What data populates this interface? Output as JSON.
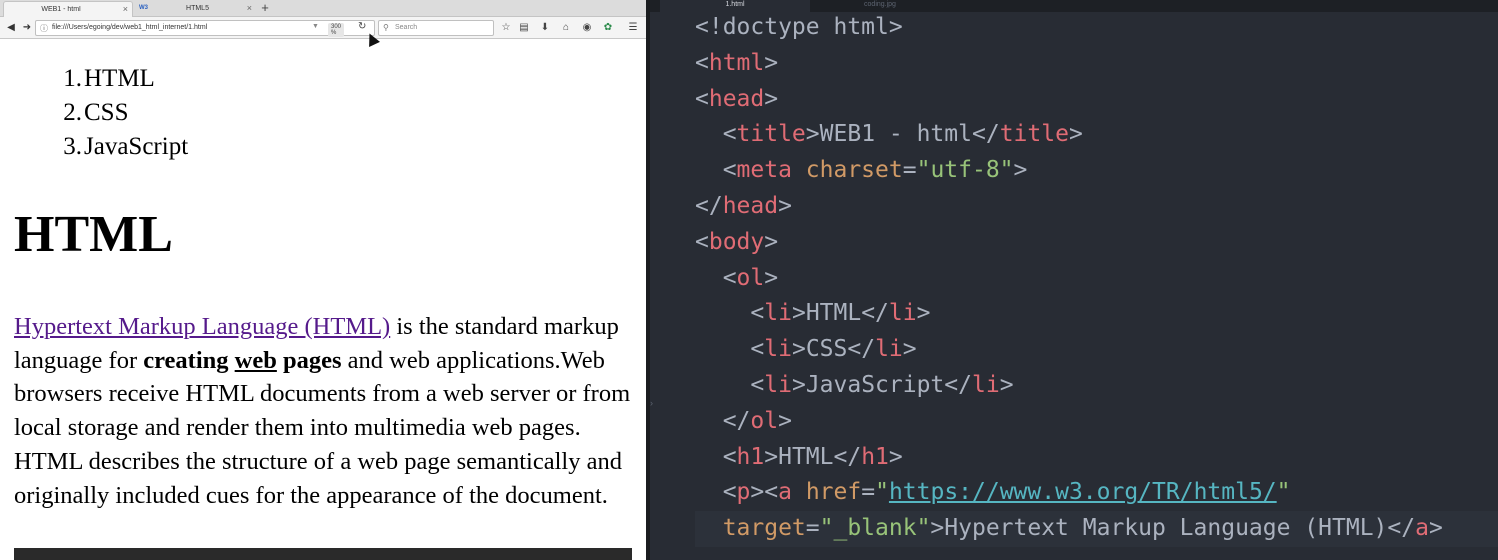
{
  "browser": {
    "tabs": [
      {
        "label": "WEB1 - html",
        "active": true
      },
      {
        "label": "",
        "favicon": "W3",
        "active": false
      },
      {
        "label": "HTML5",
        "active": false
      }
    ],
    "close_glyph": "×",
    "new_tab_glyph": "+",
    "url": "file:///Users/egoing/dev/web1_html_internet/1.html",
    "zoom": "300 %",
    "search_placeholder": "Search",
    "icons": {
      "back": "back-arrow-icon",
      "forward": "forward-arrow-icon",
      "info": "info-icon",
      "reload": "reload-icon",
      "search": "search-icon",
      "bookmark": "star-icon",
      "library": "clipboard-icon",
      "download": "download-icon",
      "home": "home-icon",
      "pocket": "pocket-icon",
      "extension": "extension-icon",
      "menu": "hamburger-menu-icon"
    }
  },
  "page": {
    "list": [
      {
        "num": "1.",
        "text": "HTML"
      },
      {
        "num": "2.",
        "text": "CSS"
      },
      {
        "num": "3.",
        "text": "JavaScript"
      }
    ],
    "heading": "HTML",
    "paragraph": {
      "link_text": "Hypertext Markup Language (HTML)",
      "text1": " is the standard markup language for ",
      "bold1": "creating ",
      "bold_underline": "web",
      "bold2": " pages",
      "text2": " and web applications.Web browsers receive HTML documents from a web server or from local storage and render them into multimedia web pages. HTML describes the structure of a web page semantically and originally included cues for the appearance of the document."
    }
  },
  "editor": {
    "tabs": [
      {
        "label": "1.html",
        "active": true
      },
      {
        "label": "coding.jpg",
        "active": false
      }
    ],
    "gutter_mark": "›",
    "lines": [
      [
        {
          "c": "punc",
          "t": "<!doctype html>"
        }
      ],
      [
        {
          "c": "punc",
          "t": "<"
        },
        {
          "c": "tag",
          "t": "html"
        },
        {
          "c": "punc",
          "t": ">"
        }
      ],
      [
        {
          "c": "punc",
          "t": "<"
        },
        {
          "c": "tag",
          "t": "head"
        },
        {
          "c": "punc",
          "t": ">"
        }
      ],
      [
        {
          "c": "punc",
          "t": "  <"
        },
        {
          "c": "tag",
          "t": "title"
        },
        {
          "c": "punc",
          "t": ">"
        },
        {
          "c": "txt",
          "t": "WEB1 - html"
        },
        {
          "c": "punc",
          "t": "</"
        },
        {
          "c": "tag",
          "t": "title"
        },
        {
          "c": "punc",
          "t": ">"
        }
      ],
      [
        {
          "c": "punc",
          "t": "  <"
        },
        {
          "c": "tag",
          "t": "meta"
        },
        {
          "c": "punc",
          "t": " "
        },
        {
          "c": "attr",
          "t": "charset"
        },
        {
          "c": "punc",
          "t": "="
        },
        {
          "c": "str",
          "t": "\"utf-8\""
        },
        {
          "c": "punc",
          "t": ">"
        }
      ],
      [
        {
          "c": "punc",
          "t": "</"
        },
        {
          "c": "tag",
          "t": "head"
        },
        {
          "c": "punc",
          "t": ">"
        }
      ],
      [
        {
          "c": "punc",
          "t": "<"
        },
        {
          "c": "tag",
          "t": "body"
        },
        {
          "c": "punc",
          "t": ">"
        }
      ],
      [
        {
          "c": "punc",
          "t": "  <"
        },
        {
          "c": "tag",
          "t": "ol"
        },
        {
          "c": "punc",
          "t": ">"
        }
      ],
      [
        {
          "c": "punc",
          "t": "    <"
        },
        {
          "c": "tag",
          "t": "li"
        },
        {
          "c": "punc",
          "t": ">"
        },
        {
          "c": "txt",
          "t": "HTML"
        },
        {
          "c": "punc",
          "t": "</"
        },
        {
          "c": "tag",
          "t": "li"
        },
        {
          "c": "punc",
          "t": ">"
        }
      ],
      [
        {
          "c": "punc",
          "t": "    <"
        },
        {
          "c": "tag",
          "t": "li"
        },
        {
          "c": "punc",
          "t": ">"
        },
        {
          "c": "txt",
          "t": "CSS"
        },
        {
          "c": "punc",
          "t": "</"
        },
        {
          "c": "tag",
          "t": "li"
        },
        {
          "c": "punc",
          "t": ">"
        }
      ],
      [
        {
          "c": "punc",
          "t": "    <"
        },
        {
          "c": "tag",
          "t": "li"
        },
        {
          "c": "punc",
          "t": ">"
        },
        {
          "c": "txt",
          "t": "JavaScript"
        },
        {
          "c": "punc",
          "t": "</"
        },
        {
          "c": "tag",
          "t": "li"
        },
        {
          "c": "punc",
          "t": ">"
        }
      ],
      [
        {
          "c": "punc",
          "t": "  </"
        },
        {
          "c": "tag",
          "t": "ol"
        },
        {
          "c": "punc",
          "t": ">"
        }
      ],
      [
        {
          "c": "punc",
          "t": "  <"
        },
        {
          "c": "tag",
          "t": "h1"
        },
        {
          "c": "punc",
          "t": ">"
        },
        {
          "c": "txt",
          "t": "HTML"
        },
        {
          "c": "punc",
          "t": "</"
        },
        {
          "c": "tag",
          "t": "h1"
        },
        {
          "c": "punc",
          "t": ">"
        }
      ],
      [
        {
          "c": "punc",
          "t": "  <"
        },
        {
          "c": "tag",
          "t": "p"
        },
        {
          "c": "punc",
          "t": "><"
        },
        {
          "c": "tag",
          "t": "a"
        },
        {
          "c": "punc",
          "t": " "
        },
        {
          "c": "attr",
          "t": "href"
        },
        {
          "c": "punc",
          "t": "="
        },
        {
          "c": "str",
          "t": "\""
        },
        {
          "c": "link",
          "t": "https://www.w3.org/TR/html5/"
        },
        {
          "c": "str",
          "t": "\""
        }
      ],
      [
        {
          "c": "attr",
          "t": "  target"
        },
        {
          "c": "punc",
          "t": "="
        },
        {
          "c": "str",
          "t": "\"_blank\""
        },
        {
          "c": "punc",
          "t": ">"
        },
        {
          "c": "txt",
          "t": "Hypertext Markup Language (HTML)"
        },
        {
          "c": "punc",
          "t": "</"
        },
        {
          "c": "tag",
          "t": "a"
        },
        {
          "c": "punc",
          "t": ">"
        }
      ]
    ],
    "current_line": 14
  }
}
